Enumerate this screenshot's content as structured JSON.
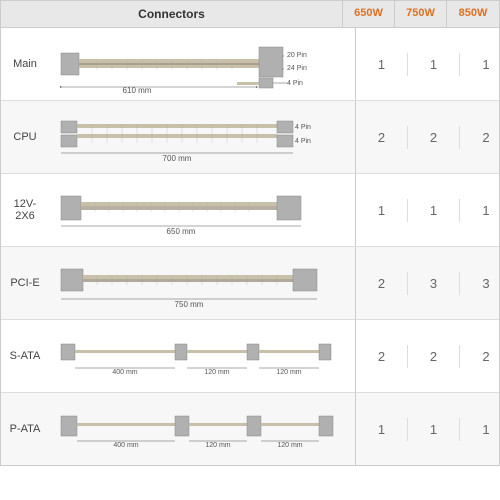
{
  "header": {
    "connectors_label": "Connectors",
    "watt_650": "650W",
    "watt_750": "750W",
    "watt_850": "850W"
  },
  "rows": [
    {
      "label": "Main",
      "diagram_type": "main",
      "dim1": "20 Pin",
      "dim2": "24 Pin",
      "dim3": "4 Pin",
      "length": "610 mm",
      "val_650": "1",
      "val_750": "1",
      "val_850": "1"
    },
    {
      "label": "CPU",
      "diagram_type": "cpu",
      "dim1": "4 Pin",
      "dim2": "4 Pin",
      "length": "700 mm",
      "val_650": "2",
      "val_750": "2",
      "val_850": "2"
    },
    {
      "label": "12V-2X6",
      "diagram_type": "12v2x6",
      "length": "650 mm",
      "val_650": "1",
      "val_750": "1",
      "val_850": "1"
    },
    {
      "label": "PCI-E",
      "diagram_type": "pcie",
      "length": "750 mm",
      "val_650": "2",
      "val_750": "3",
      "val_850": "3"
    },
    {
      "label": "S-ATA",
      "diagram_type": "sata",
      "length1": "400 mm",
      "length2": "120 mm",
      "length3": "120 mm",
      "val_650": "2",
      "val_750": "2",
      "val_850": "2"
    },
    {
      "label": "P-ATA",
      "diagram_type": "pata",
      "length1": "400 mm",
      "length2": "120 mm",
      "length3": "120 mm",
      "val_650": "1",
      "val_750": "1",
      "val_850": "1"
    }
  ]
}
